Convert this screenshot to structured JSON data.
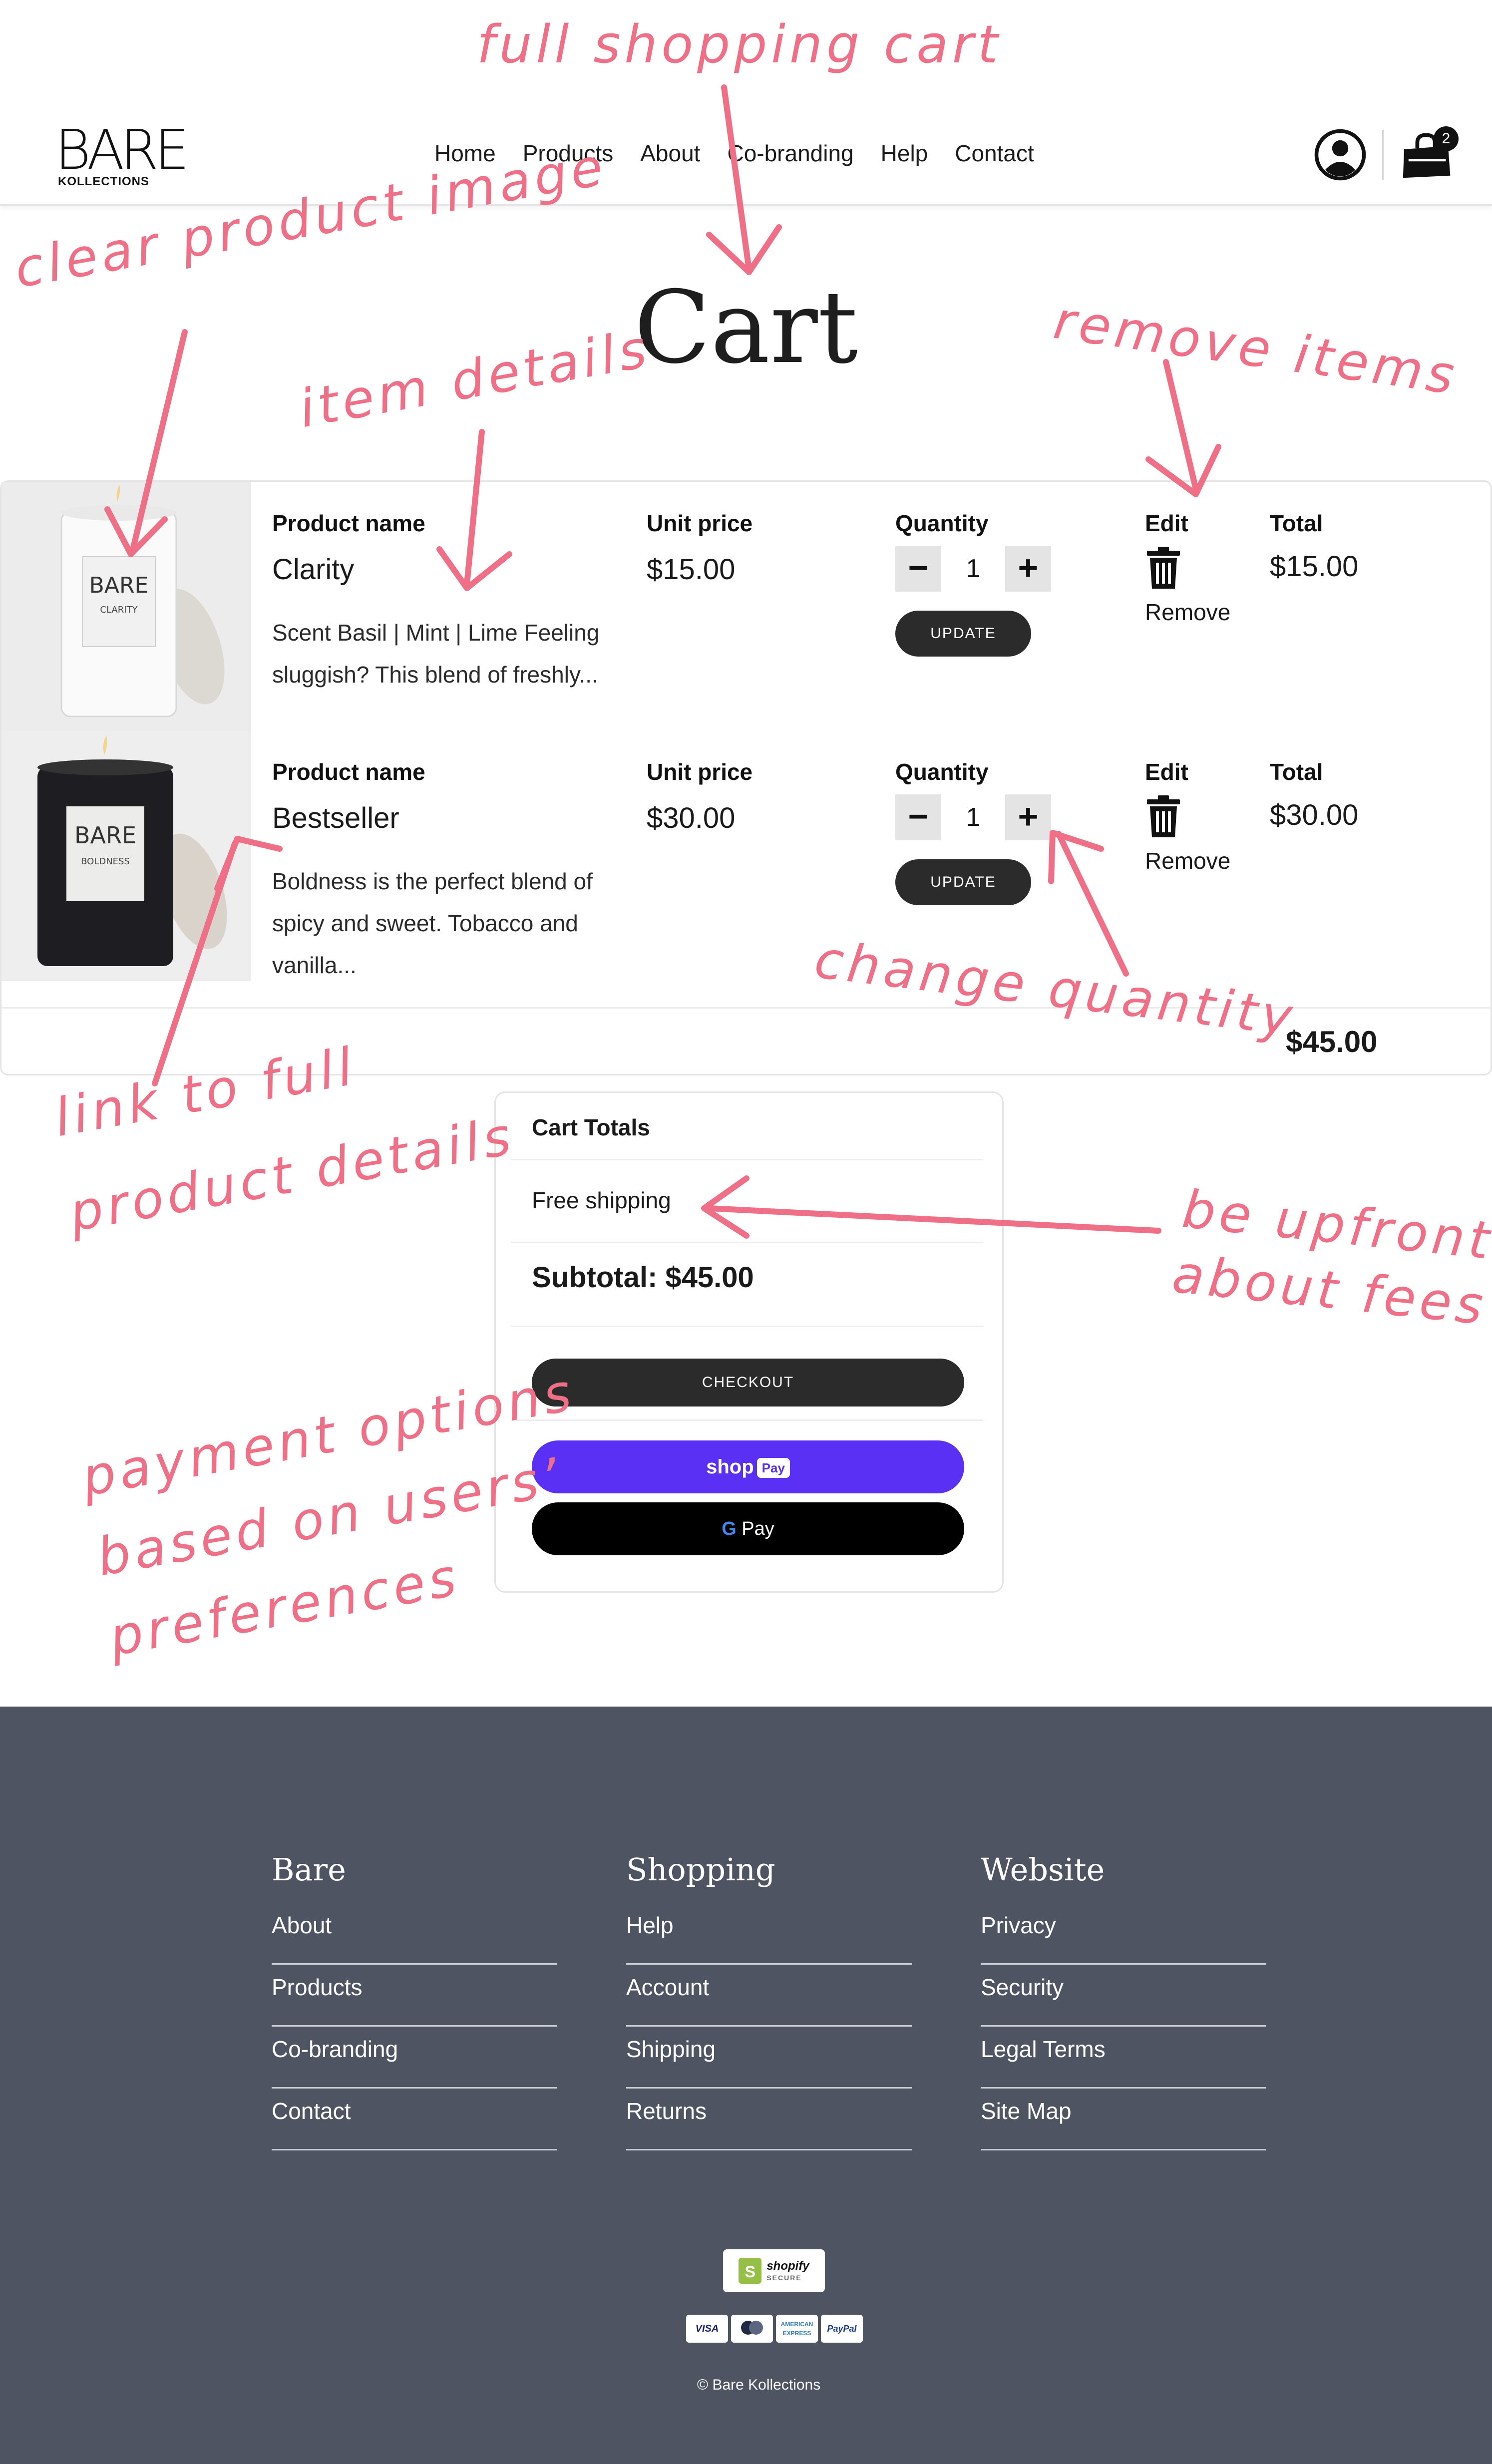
{
  "header": {
    "logo_text": "BARE",
    "logo_sub": "KOLLECTIONS",
    "nav": [
      "Home",
      "Products",
      "About",
      "Co-branding",
      "Help",
      "Contact"
    ],
    "cart_count": "2"
  },
  "page_title": "Cart",
  "columns": {
    "product_name": "Product name",
    "unit_price": "Unit price",
    "quantity": "Quantity",
    "edit": "Edit",
    "total": "Total"
  },
  "items": [
    {
      "name": "Clarity",
      "description": "Scent Basil | Mint | Lime Feeling sluggish? This blend of freshly...",
      "image_label": "CLARITY",
      "unit_price": "$15.00",
      "quantity": "1",
      "update_label": "UPDATE",
      "remove_label": "Remove",
      "total": "$15.00"
    },
    {
      "name": "Bestseller",
      "description": "Boldness is the perfect blend of spicy and sweet. Tobacco and vanilla...",
      "image_label": "BOLDNESS",
      "unit_price": "$30.00",
      "quantity": "1",
      "update_label": "UPDATE",
      "remove_label": "Remove",
      "total": "$30.00"
    }
  ],
  "cart_total": "$45.00",
  "totals_box": {
    "heading": "Cart Totals",
    "shipping": "Free shipping",
    "subtotal": "Subtotal: $45.00",
    "checkout_label": "CHECKOUT",
    "shoppay_label": "shop",
    "shoppay_tag": "Pay",
    "gpay_g": "G",
    "gpay_label": " Pay"
  },
  "annotations": {
    "full_cart": "full shopping cart",
    "clear_image": "clear product image",
    "item_details": "item details",
    "remove_items": "remove items",
    "change_quantity": "change quantity",
    "link_details_1": "link to full",
    "link_details_2": "product details",
    "upfront_1": "be upfront",
    "upfront_2": "about fees",
    "payment_1": "payment options",
    "payment_2": "based on users’",
    "payment_3": "preferences"
  },
  "footer": {
    "columns": [
      {
        "title": "Bare",
        "links": [
          "About",
          "Products",
          "Co-branding",
          "Contact"
        ]
      },
      {
        "title": "Shopping",
        "links": [
          "Help",
          "Account",
          "Shipping",
          "Returns"
        ]
      },
      {
        "title": "Website",
        "links": [
          "Privacy",
          "Security",
          "Legal Terms",
          "Site Map"
        ]
      }
    ],
    "shopify_badge": "shopify",
    "shopify_secure": "SECURE",
    "cards": [
      "VISA",
      "MC",
      "AMERICAN EXPRESS",
      "PayPal"
    ],
    "copyright": "© Bare Kollections"
  },
  "colors": {
    "annotation": "#ef6f86",
    "footer_bg": "#4f5463",
    "shop_pay": "#5a31f4",
    "button_dark": "#2b2b2b"
  }
}
